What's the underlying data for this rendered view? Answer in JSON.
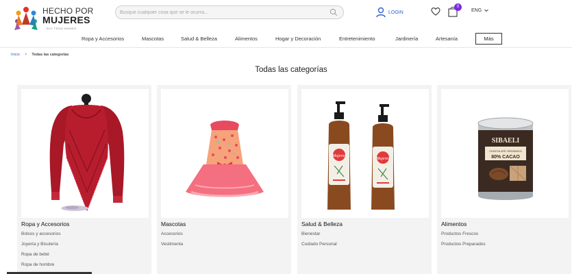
{
  "brand": {
    "line1": "HECHO POR",
    "line2": "MUJERES",
    "tagline": "BUY FROM WOMEN"
  },
  "search": {
    "placeholder": "Busque cualquier cosa que se le ocurra...",
    "icon": "search-icon"
  },
  "account": {
    "login_label": "LOGIN",
    "cart_count": "0",
    "language": "ENG"
  },
  "colors": {
    "accent": "#2f5fd0",
    "badge": "#7b2ae3"
  },
  "nav": {
    "items": [
      "Ropa y Accesorios",
      "Mascotas",
      "Salud & Belleza",
      "Alimentos",
      "Hogar y Decoración",
      "Entretenimiento",
      "Jardinería",
      "Artesanía"
    ],
    "more_label": "Más"
  },
  "breadcrumb": {
    "home": "Inicio",
    "separator": ">",
    "current": "Todas las categorías"
  },
  "page_title": "Todas las categorías",
  "categories": [
    {
      "title": "Ropa y Accesorios",
      "links": [
        "Bolsos y accesorios",
        "Joyería y Bisutería",
        "Ropa de bebé",
        "Ropa de hombre"
      ]
    },
    {
      "title": "Mascotas",
      "links": [
        "Accesorios",
        "Vestimenta"
      ]
    },
    {
      "title": "Salud & Belleza",
      "links": [
        "Bienestar",
        "Cuidado Personal"
      ]
    },
    {
      "title": "Alimentos",
      "links": [
        "Productos Frescos",
        "Productos Preparados"
      ]
    }
  ],
  "product_labels": {
    "bottle_brand": "Mujeres",
    "tin_brand": "SIBAELI",
    "tin_line1": "CHOCOLATE ORGÁNICO",
    "tin_line2": "80% CACAO"
  }
}
